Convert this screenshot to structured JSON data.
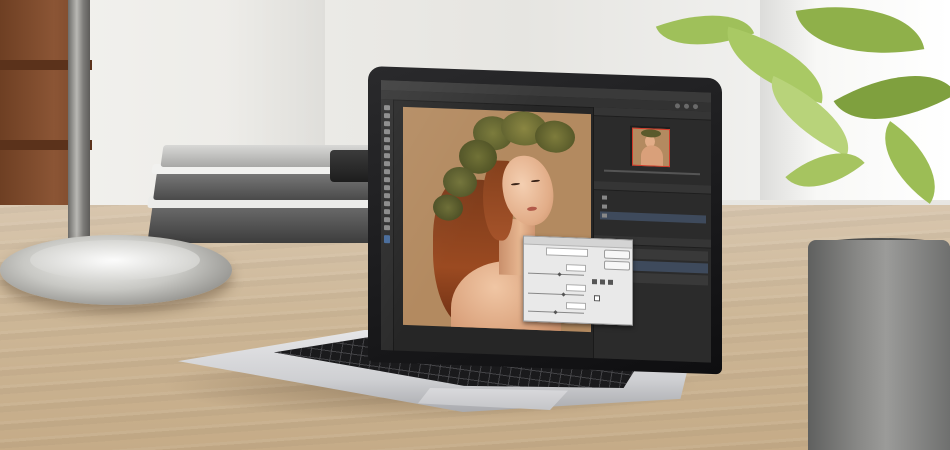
{
  "scene": {
    "description_icons": [
      "desk-lamp-icon",
      "laptop-icon",
      "plant-icon",
      "book-stack-icon"
    ],
    "colors": {
      "desk": "#cdb797",
      "wall": "#ecebe7",
      "laptop_lid": "#141416",
      "canvas_background": "#b38a60",
      "ps_dark_ui": "#2b2b2b",
      "plant_leaf": "#8fb04a",
      "pot": "#888886"
    }
  }
}
